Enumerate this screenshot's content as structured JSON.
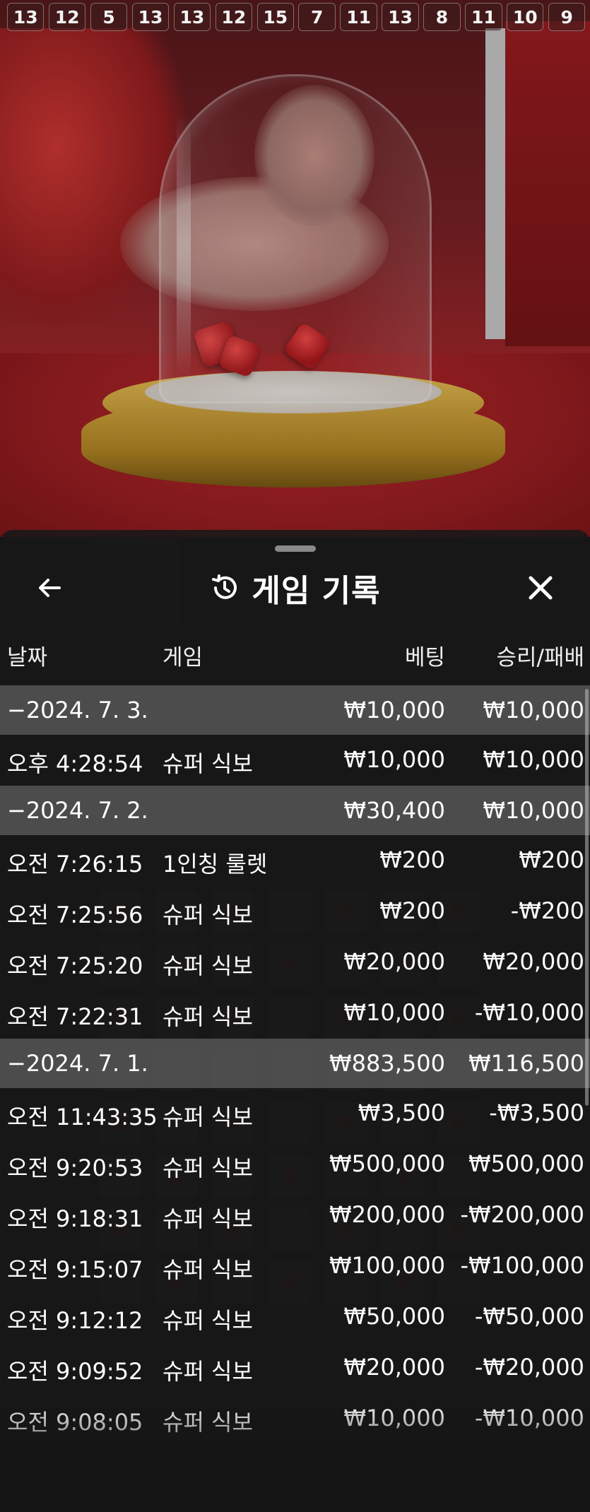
{
  "history_strip": [
    "13",
    "12",
    "5",
    "13",
    "13",
    "12",
    "15",
    "7",
    "11",
    "13",
    "8",
    "11",
    "10",
    "9"
  ],
  "sheet": {
    "title": "게임 기록",
    "icons": {
      "back": "arrow-left-icon",
      "close": "close-icon",
      "title": "history-icon"
    }
  },
  "columns": {
    "date": "날짜",
    "game": "게임",
    "bet": "베팅",
    "win_loss": "승리/패배"
  },
  "rows": [
    {
      "type": "group",
      "date": "−2024. 7. 3.",
      "game": "",
      "bet": "₩10,000",
      "win": "₩10,000"
    },
    {
      "type": "entry",
      "date": "오후 4:28:54",
      "game": "슈퍼 식보",
      "bet": "₩10,000",
      "win": "₩10,000"
    },
    {
      "type": "group",
      "date": "−2024. 7. 2.",
      "game": "",
      "bet": "₩30,400",
      "win": "₩10,000"
    },
    {
      "type": "entry",
      "date": "오전 7:26:15",
      "game": "1인칭 룰렛",
      "bet": "₩200",
      "win": "₩200"
    },
    {
      "type": "entry",
      "date": "오전 7:25:56",
      "game": "슈퍼 식보",
      "bet": "₩200",
      "win": "-₩200"
    },
    {
      "type": "entry",
      "date": "오전 7:25:20",
      "game": "슈퍼 식보",
      "bet": "₩20,000",
      "win": "₩20,000"
    },
    {
      "type": "entry",
      "date": "오전 7:22:31",
      "game": "슈퍼 식보",
      "bet": "₩10,000",
      "win": "-₩10,000"
    },
    {
      "type": "group",
      "date": "−2024. 7. 1.",
      "game": "",
      "bet": "₩883,500",
      "win": "₩116,500"
    },
    {
      "type": "entry",
      "date": "오전 11:43:35",
      "game": "슈퍼 식보",
      "bet": "₩3,500",
      "win": "-₩3,500"
    },
    {
      "type": "entry",
      "date": "오전 9:20:53",
      "game": "슈퍼 식보",
      "bet": "₩500,000",
      "win": "₩500,000"
    },
    {
      "type": "entry",
      "date": "오전 9:18:31",
      "game": "슈퍼 식보",
      "bet": "₩200,000",
      "win": "-₩200,000"
    },
    {
      "type": "entry",
      "date": "오전 9:15:07",
      "game": "슈퍼 식보",
      "bet": "₩100,000",
      "win": "-₩100,000"
    },
    {
      "type": "entry",
      "date": "오전 9:12:12",
      "game": "슈퍼 식보",
      "bet": "₩50,000",
      "win": "-₩50,000"
    },
    {
      "type": "entry",
      "date": "오전 9:09:52",
      "game": "슈퍼 식보",
      "bet": "₩20,000",
      "win": "-₩20,000"
    },
    {
      "type": "entry",
      "date": "오전 9:08:05",
      "game": "슈퍼 식보",
      "bet": "₩10,000",
      "win": "-₩10,000"
    }
  ],
  "colors": {
    "sheet_bg": "#181818",
    "group_row_bg": "#5a5a5a",
    "text": "#ffffff"
  }
}
